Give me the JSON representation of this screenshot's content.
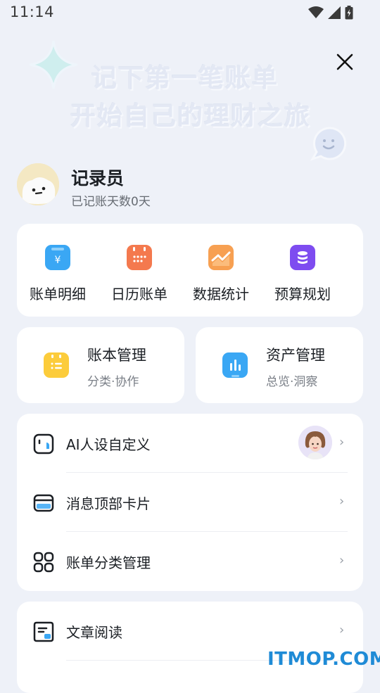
{
  "status": {
    "time": "11:14"
  },
  "banner": {
    "line1": "记下第一笔账单",
    "line2": "开始自己的理财之旅"
  },
  "profile": {
    "name": "记录员",
    "subtitle": "已记账天数0天"
  },
  "quick": [
    {
      "label": "账单明细",
      "icon": "bill-icon",
      "color": "#3aa7f4"
    },
    {
      "label": "日历账单",
      "icon": "calendar-icon",
      "color": "#f4794e"
    },
    {
      "label": "数据统计",
      "icon": "chart-icon",
      "color": "#f7a052"
    },
    {
      "label": "预算规划",
      "icon": "database-icon",
      "color": "#7e4cf0"
    }
  ],
  "books": {
    "title": "账本管理",
    "subtitle": "分类·协作"
  },
  "assets": {
    "title": "资产管理",
    "subtitle": "总览·洞察"
  },
  "menu": [
    {
      "label": "AI人设自定义",
      "icon": "robot-icon"
    },
    {
      "label": "消息顶部卡片",
      "icon": "card-icon"
    },
    {
      "label": "账单分类管理",
      "icon": "grid-icon"
    }
  ],
  "menu2": [
    {
      "label": "文章阅读",
      "icon": "article-icon"
    }
  ],
  "chevron": "›",
  "watermark": "ITMOP.COM"
}
